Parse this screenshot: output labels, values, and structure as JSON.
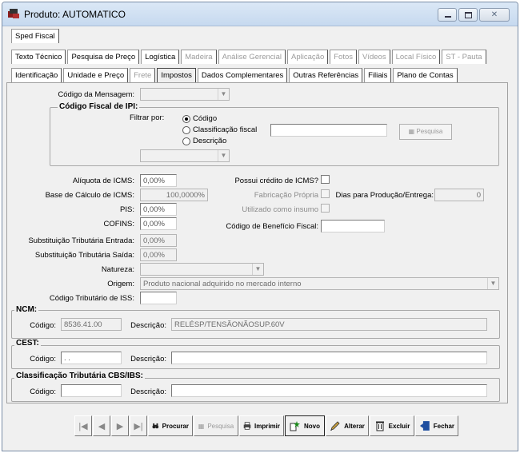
{
  "window": {
    "title": "Produto: AUTOMATICO"
  },
  "tabs_row1": [
    {
      "label": "Sped Fiscal",
      "state": "normal"
    }
  ],
  "tabs_row2": [
    {
      "label": "Texto Técnico",
      "state": "normal"
    },
    {
      "label": "Pesquisa de Preço",
      "state": "normal"
    },
    {
      "label": "Logística",
      "state": "normal"
    },
    {
      "label": "Madeira",
      "state": "disabled"
    },
    {
      "label": "Análise Gerencial",
      "state": "disabled"
    },
    {
      "label": "Aplicação",
      "state": "disabled"
    },
    {
      "label": "Fotos",
      "state": "disabled"
    },
    {
      "label": "Vídeos",
      "state": "disabled"
    },
    {
      "label": "Local Físico",
      "state": "disabled"
    },
    {
      "label": "ST - Pauta",
      "state": "disabled"
    }
  ],
  "tabs_row3": [
    {
      "label": "Identificação",
      "state": "normal"
    },
    {
      "label": "Unidade e Preço",
      "state": "normal"
    },
    {
      "label": "Frete",
      "state": "disabled"
    },
    {
      "label": "Impostos",
      "state": "active"
    },
    {
      "label": "Dados Complementares",
      "state": "normal"
    },
    {
      "label": "Outras Referências",
      "state": "normal"
    },
    {
      "label": "Filiais",
      "state": "normal"
    },
    {
      "label": "Plano de Contas",
      "state": "normal"
    }
  ],
  "form": {
    "codigo_mensagem_label": "Código da Mensagem:",
    "ipi_group_title": "Código Fiscal de IPI:",
    "filtrar_por_label": "Filtrar por:",
    "filter_options": [
      "Código",
      "Classificação fiscal",
      "Descrição"
    ],
    "pesquisa_btn": "Pesquisa",
    "aliquota_icms_label": "Alíquota de ICMS:",
    "aliquota_icms_value": "0,00%",
    "base_calculo_label": "Base de Cálculo de ICMS:",
    "base_calculo_value": "100,0000%",
    "pis_label": "PIS:",
    "pis_value": "0,00%",
    "cofins_label": "COFINS:",
    "cofins_value": "0,00%",
    "st_entrada_label": "Substituição Tributária Entrada:",
    "st_entrada_value": "0,00%",
    "st_saida_label": "Substituição Tributária Saída:",
    "st_saida_value": "0,00%",
    "natureza_label": "Natureza:",
    "origem_label": "Origem:",
    "origem_value": "Produto nacional adquirido no mercado interno",
    "cod_trib_iss_label": "Código Tributário de ISS:",
    "possui_credito_label": "Possui crédito de ICMS?",
    "fabricacao_propria_label": "Fabricação Própria",
    "utilizado_insumo_label": "Utilizado como insumo",
    "dias_producao_label": "Dias para Produção/Entrega:",
    "dias_producao_value": "0",
    "cod_beneficio_label": "Código de Benefício Fiscal:"
  },
  "ncm": {
    "title": "NCM:",
    "codigo_label": "Código:",
    "codigo_value": "8536.41.00",
    "descricao_label": "Descrição:",
    "descricao_value": "RELÉSP/TENSÃONÃOSUP.60V"
  },
  "cest": {
    "title": "CEST:",
    "codigo_label": "Código:",
    "codigo_value": " .  .",
    "descricao_label": "Descrição:",
    "descricao_value": ""
  },
  "cbs": {
    "title": "Classificação Tributária CBS/IBS:",
    "codigo_label": "Código:",
    "codigo_value": "",
    "descricao_label": "Descrição:",
    "descricao_value": ""
  },
  "toolbar": {
    "first": "|◀",
    "prev": "◀",
    "next": "▶",
    "last": "▶|",
    "procurar": "Procurar",
    "pesquisa": "Pesquisa",
    "imprimir": "Imprimir",
    "novo": "Novo",
    "alterar": "Alterar",
    "excluir": "Excluir",
    "fechar": "Fechar"
  }
}
